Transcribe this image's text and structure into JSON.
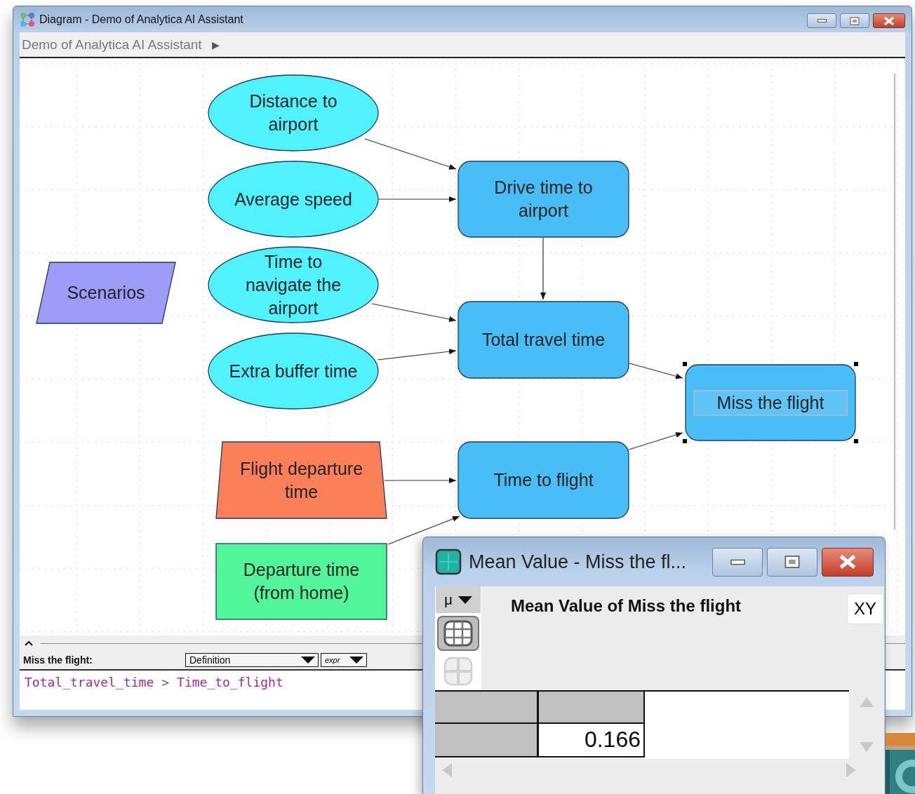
{
  "window": {
    "title": "Diagram - Demo of Analytica AI Assistant"
  },
  "breadcrumb": {
    "label": "Demo of Analytica AI Assistant",
    "arrow": "▶"
  },
  "diagram": {
    "nodes": [
      {
        "kind": "chance",
        "label": "Distance to\nairport",
        "color": "#4ff2fd",
        "selected": false
      },
      {
        "kind": "chance",
        "label": "Average speed",
        "color": "#4ff2fd",
        "selected": false
      },
      {
        "kind": "chance",
        "label": "Time to\nnavigate the\nairport",
        "color": "#4ff2fd",
        "selected": false
      },
      {
        "kind": "chance",
        "label": "Extra buffer time",
        "color": "#4ff2fd",
        "selected": false
      },
      {
        "kind": "index",
        "label": "Scenarios",
        "color": "#9d9cf6",
        "selected": false
      },
      {
        "kind": "variable",
        "label": "Drive time to\nairport",
        "color": "#49bdf6",
        "selected": false
      },
      {
        "kind": "variable",
        "label": "Total travel time",
        "color": "#49bdf6",
        "selected": false
      },
      {
        "kind": "variable",
        "label": "Miss the flight",
        "color": "#49bdf6",
        "selected": true
      },
      {
        "kind": "decision",
        "label": "Flight departure\ntime",
        "color": "#fb8059",
        "selected": false
      },
      {
        "kind": "variable",
        "label": "Time to flight",
        "color": "#49bdf6",
        "selected": false
      },
      {
        "kind": "constant",
        "label": "Departure time\n(from home)",
        "color": "#52f59a",
        "selected": false
      }
    ]
  },
  "attribute_pane": {
    "node_label": "Miss the flight:",
    "attribute": "Definition",
    "view": "expr",
    "definition": [
      {
        "kind": "identifier",
        "text": "Total_travel_time"
      },
      {
        "kind": "operator",
        "text": ">"
      },
      {
        "kind": "identifier",
        "text": "Time_to_flight"
      }
    ]
  },
  "result_window": {
    "title": "Mean Value - Miss the fl...",
    "view_menu": "μ",
    "heading": "Mean Value of Miss the flight",
    "xy_button": "XY",
    "views": [
      {
        "kind": "table",
        "selected": true
      },
      {
        "kind": "graph",
        "selected": false
      }
    ],
    "table": {
      "value": "0.166"
    }
  }
}
